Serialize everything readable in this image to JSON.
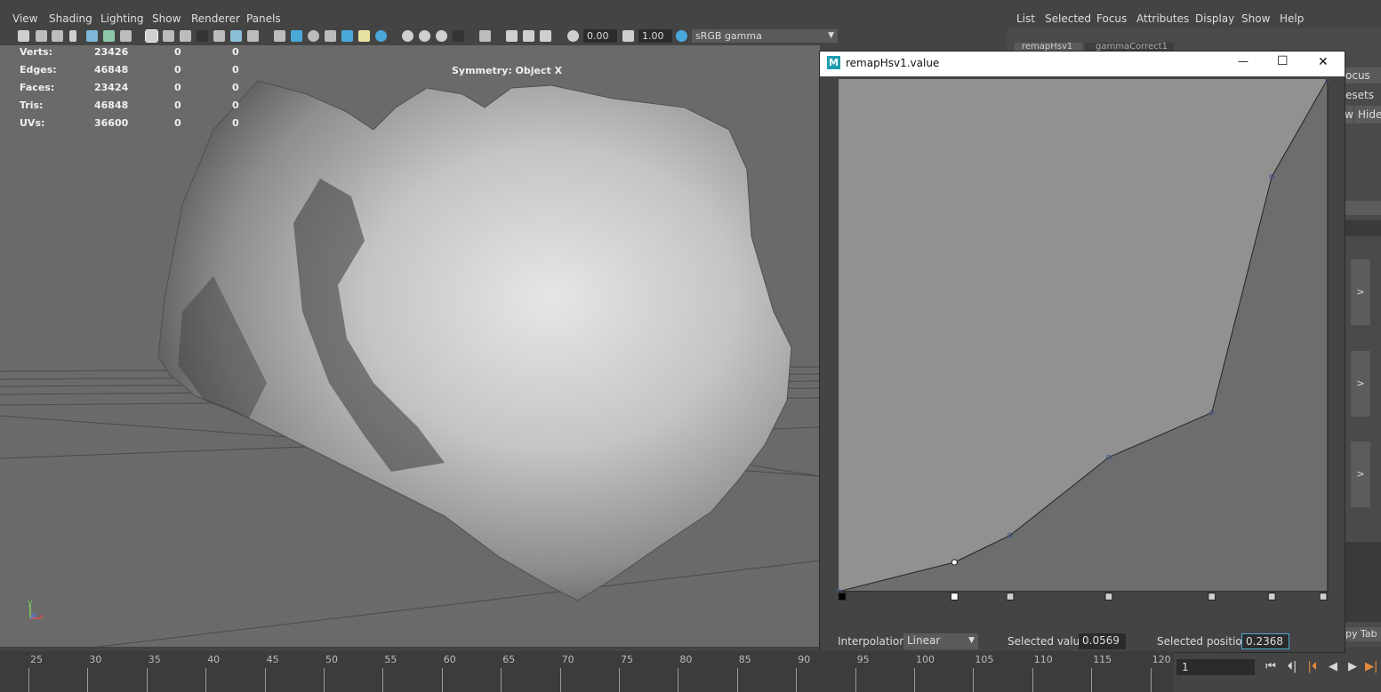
{
  "viewport": {
    "menus": [
      "View",
      "Shading",
      "Lighting",
      "Show",
      "Renderer",
      "Panels"
    ],
    "toolbar": {
      "exposure_value": "0.00",
      "gamma_value": "1.00",
      "color_space": "sRGB gamma"
    },
    "stats": [
      {
        "label": "Verts:",
        "value": "23426",
        "sel": "0",
        "comp": "0"
      },
      {
        "label": "Edges:",
        "value": "46848",
        "sel": "0",
        "comp": "0"
      },
      {
        "label": "Faces:",
        "value": "23424",
        "sel": "0",
        "comp": "0"
      },
      {
        "label": "Tris:",
        "value": "46848",
        "sel": "0",
        "comp": "0"
      },
      {
        "label": "UVs:",
        "value": "36600",
        "sel": "0",
        "comp": "0"
      }
    ],
    "symmetry": "Symmetry: Object X",
    "axis": {
      "y": "y",
      "z": "z",
      "x": "x"
    }
  },
  "right_panel": {
    "menus": [
      "List",
      "Selected",
      "Focus",
      "Attributes",
      "Display",
      "Show",
      "Help"
    ],
    "tabs_partial": [
      "remapHsv1",
      "gammaCorrect1"
    ],
    "side_labels": {
      "focus": "ocus",
      "presets": "esets",
      "show": "Show",
      "hide": "Hide",
      "copy_tab": "py Tab"
    },
    "expand_label": ">"
  },
  "dialog": {
    "title": "remapHsv1.value",
    "icon_letter": "M",
    "window_buttons": {
      "minimize": "—",
      "maximize": "☐",
      "close": "✕"
    },
    "interpolation_label": "Interpolation:",
    "interpolation_value": "Linear",
    "selected_value_label": "Selected value:",
    "selected_value": "0.0569",
    "selected_position_label": "Selected position:",
    "selected_position": "0.2368",
    "curve_points": [
      {
        "position": 0.0,
        "value": 0.0
      },
      {
        "position": 0.2368,
        "value": 0.0569
      },
      {
        "position": 0.3509,
        "value": 0.1095
      },
      {
        "position": 0.5526,
        "value": 0.2618
      },
      {
        "position": 0.7632,
        "value": 0.3488
      },
      {
        "position": 0.886,
        "value": 0.8095
      },
      {
        "position": 1.0,
        "value": 1.0
      }
    ],
    "selected_index": 1
  },
  "timeline": {
    "ticks": [
      "25",
      "30",
      "35",
      "40",
      "45",
      "50",
      "55",
      "60",
      "65",
      "70",
      "75",
      "80",
      "85",
      "90",
      "95",
      "100",
      "105",
      "110",
      "115",
      "120"
    ],
    "current_frame": "1",
    "playback": [
      "⏮",
      "⏴|",
      "|⏴",
      "◀",
      "▶",
      "▶|"
    ]
  },
  "colors": {
    "ui_bg": "#444444",
    "viewport_bg": "#6a6a6a",
    "graph_upper": "#919191",
    "graph_lower": "#6d6d6d",
    "accent": "#4aa8d8",
    "point_stroke": "#3c5a8c"
  }
}
